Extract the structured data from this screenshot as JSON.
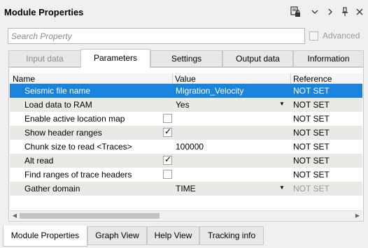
{
  "window": {
    "title": "Module Properties",
    "icons": [
      "lock-icon",
      "chevron-down-icon",
      "chevron-right-icon",
      "pin-icon",
      "close-icon"
    ]
  },
  "search": {
    "placeholder": "Search Property",
    "value": ""
  },
  "advanced": {
    "label": "Advanced",
    "checked": false,
    "enabled": false
  },
  "tabs": [
    {
      "label": "Input data",
      "state": "disabled"
    },
    {
      "label": "Parameters",
      "state": "active"
    },
    {
      "label": "Settings",
      "state": "normal"
    },
    {
      "label": "Output data",
      "state": "normal"
    },
    {
      "label": "Information",
      "state": "normal"
    }
  ],
  "grid": {
    "columns": [
      "Name",
      "Value",
      "Reference"
    ],
    "rows": [
      {
        "name": "Seismic file name",
        "value": "Migration_Velocity",
        "type": "text",
        "reference": "NOT SET",
        "selected": true
      },
      {
        "name": "Load data to RAM",
        "value": "Yes",
        "type": "dropdown",
        "reference": "NOT SET"
      },
      {
        "name": "Enable active location map",
        "value": "",
        "type": "checkbox",
        "checked": false,
        "reference": "NOT SET"
      },
      {
        "name": "Show header ranges",
        "value": "",
        "type": "checkbox",
        "checked": true,
        "reference": "NOT SET"
      },
      {
        "name": "Chunk size to read <Traces>",
        "value": "100000",
        "type": "text",
        "reference": "NOT SET"
      },
      {
        "name": "Alt read",
        "value": "",
        "type": "checkbox",
        "checked": true,
        "reference": "NOT SET"
      },
      {
        "name": "Find ranges of trace headers",
        "value": "",
        "type": "checkbox",
        "checked": false,
        "reference": "NOT SET"
      },
      {
        "name": "Gather domain",
        "value": "TIME",
        "type": "dropdown",
        "reference": "NOT SET",
        "reference_dim": true
      }
    ]
  },
  "bottom_tabs": [
    {
      "label": "Module Properties",
      "active": true
    },
    {
      "label": "Graph View",
      "active": false
    },
    {
      "label": "Help View",
      "active": false
    },
    {
      "label": "Tracking info",
      "active": false
    }
  ],
  "colors": {
    "selection": "#1a84dc",
    "alt_row": "#ebe9e6",
    "background": "#f0f0f0"
  }
}
